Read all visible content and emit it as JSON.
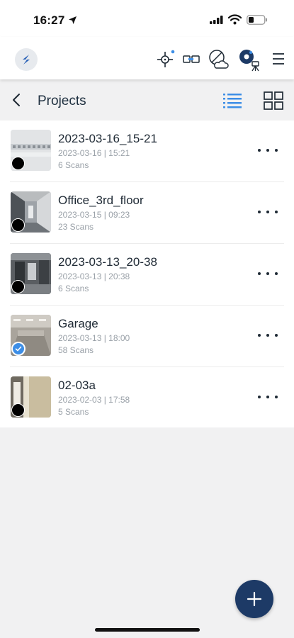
{
  "status_bar": {
    "time": "16:27"
  },
  "header": {
    "icons": [
      "app-logo-icon",
      "target-marker-icon",
      "device-link-icon",
      "cloud-off-icon",
      "scanner-icon",
      "menu-icon"
    ]
  },
  "subheader": {
    "title": "Projects"
  },
  "projects": [
    {
      "name": "2023-03-16_15-21",
      "date": "2023-03-16 | 15:21",
      "scans": "6 Scans",
      "status": "dot"
    },
    {
      "name": "Office_3rd_floor",
      "date": "2023-03-15 | 09:23",
      "scans": "23 Scans",
      "status": "dot"
    },
    {
      "name": "2023-03-13_20-38",
      "date": "2023-03-13 | 20:38",
      "scans": "6 Scans",
      "status": "dot"
    },
    {
      "name": "Garage",
      "date": "2023-03-13 | 18:00",
      "scans": "58 Scans",
      "status": "check"
    },
    {
      "name": "02-03a",
      "date": "2023-02-03 | 17:58",
      "scans": "5 Scans",
      "status": "dot"
    }
  ],
  "colors": {
    "accent": "#3d8ee6",
    "fab": "#1d3a66",
    "background": "#f1f1f2"
  }
}
